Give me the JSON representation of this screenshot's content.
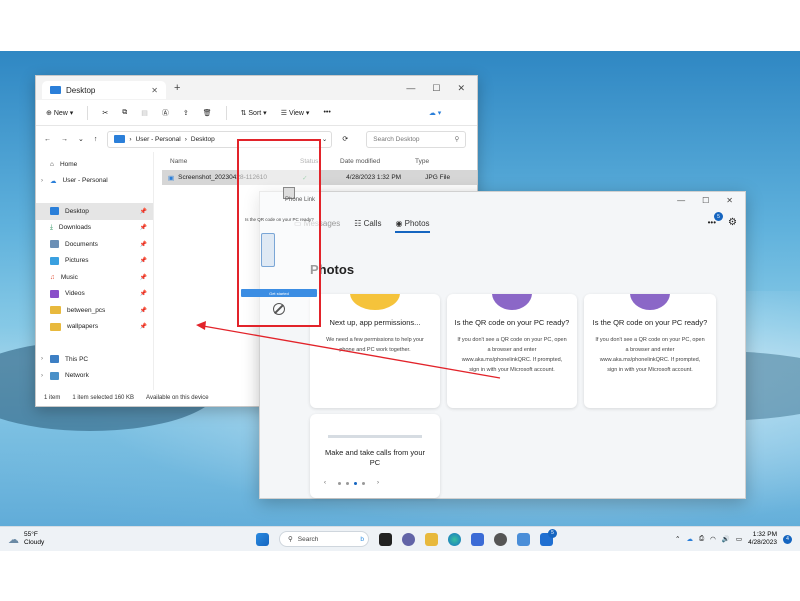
{
  "explorer": {
    "tab_title": "Desktop",
    "toolbar": {
      "new": "New",
      "sort": "Sort",
      "view": "View",
      "more": "•••"
    },
    "breadcrumb": [
      "User - Personal",
      "Desktop"
    ],
    "search_placeholder": "Search Desktop",
    "nav": {
      "home": "Home",
      "onedrive": "User - Personal",
      "pinned": [
        "Desktop",
        "Downloads",
        "Documents",
        "Pictures",
        "Music",
        "Videos",
        "between_pcs",
        "wallpapers"
      ],
      "this_pc": "This PC",
      "network": "Network"
    },
    "columns": {
      "name": "Name",
      "status": "Status",
      "date": "Date modified",
      "type": "Type"
    },
    "file": {
      "name": "Screenshot_20230428-112610",
      "date": "4/28/2023 1:32 PM",
      "type": "JPG File"
    },
    "status": {
      "items": "1 item",
      "selected": "1 item selected  160 KB",
      "availability": "Available on this device"
    }
  },
  "phone_link": {
    "tabs": {
      "messages": "Messages",
      "calls": "Calls",
      "photos": "Photos"
    },
    "notification_count": "5",
    "heading": "Photos",
    "cards": [
      {
        "title": "Next up, app permissions...",
        "body": "We need a few permissions to help your phone and PC work together."
      },
      {
        "title": "Is the QR code on your PC ready?",
        "body": "If you don't see a QR code on your PC, open a browser and enter www.aka.ms/phonelinkQRC. If prompted, sign in with your Microsoft account."
      },
      {
        "title": "Is the QR code on your PC ready?",
        "body": "If you don't see a QR code on your PC, open a browser and enter www.aka.ms/phonelinkQRC. If prompted, sign in with your Microsoft account."
      },
      {
        "title": "Make and take calls from your PC",
        "body": ""
      }
    ]
  },
  "overlay": {
    "app_name": "Phone Link",
    "question": "Is the QR code on your PC ready?",
    "button": "Get started"
  },
  "taskbar": {
    "weather_temp": "55°F",
    "weather_desc": "Cloudy",
    "search": "Search",
    "time": "1:32 PM",
    "date": "4/28/2023",
    "notifications": "4",
    "phone_badge": "5"
  },
  "colors": {
    "accent": "#1565c0",
    "annotation": "#e2232a",
    "folder": "#2b7fd9"
  }
}
